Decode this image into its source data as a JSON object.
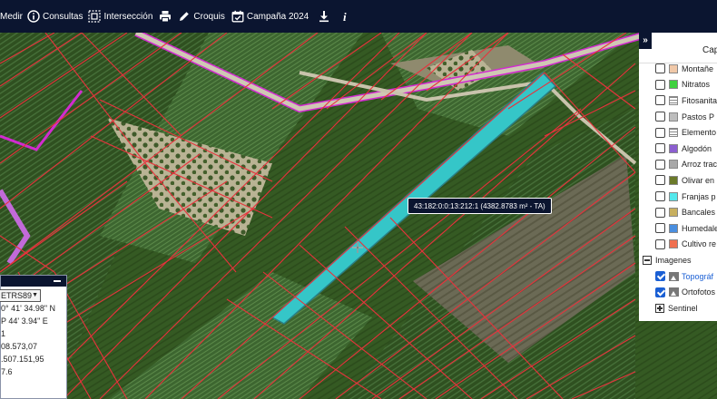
{
  "toolbar": {
    "items": [
      {
        "label": "Medir",
        "icon": "ruler-icon"
      },
      {
        "label": "Consultas",
        "icon": "info-circle-icon"
      },
      {
        "label": "Intersección",
        "icon": "intersection-icon"
      },
      {
        "label": "",
        "icon": "print-icon"
      },
      {
        "label": "Croquis",
        "icon": "pencil-icon"
      },
      {
        "label": "Campaña 2024",
        "icon": "calendar-check-icon"
      },
      {
        "label": "",
        "icon": "download-icon"
      },
      {
        "label": "",
        "icon": "info-italic-icon"
      }
    ]
  },
  "tooltip": {
    "text": "43:182:0:0:13:212:1 (4382.8783 m² - TA)"
  },
  "coord_panel": {
    "projection": "ETRS89",
    "lines": [
      "0° 41' 34.98\" N",
      "P 44' 3.94\" E",
      "1",
      "08.573,07",
      ".507.151,95",
      "7.6"
    ]
  },
  "layer_panel": {
    "title": "Cap",
    "layers": [
      {
        "label": "Montañe",
        "color": "#f0c8a8",
        "checked": false
      },
      {
        "label": "Nitratos",
        "color": "#3fd13f",
        "checked": false
      },
      {
        "label": "Fitosanita",
        "color": "lines",
        "checked": false
      },
      {
        "label": "Pastos P",
        "color": "#bdbdbd",
        "checked": false
      },
      {
        "label": "Elemento",
        "color": "lines",
        "checked": false
      },
      {
        "label": "Algodón",
        "color": "#8c5fd0",
        "checked": false
      },
      {
        "label": "Arroz trac",
        "color": "#a8a8a8",
        "checked": false
      },
      {
        "label": "Olivar en",
        "color": "#6b7a2a",
        "checked": false
      },
      {
        "label": "Franjas p",
        "color": "#54e8ec",
        "checked": false
      },
      {
        "label": "Bancales",
        "color": "#c8b060",
        "checked": false
      },
      {
        "label": "Humedale",
        "color": "#4a8fe0",
        "checked": false
      },
      {
        "label": "Cultivo re",
        "color": "#f07050",
        "checked": false
      }
    ],
    "group_label": "Imagenes",
    "images": [
      {
        "label": "Topográf",
        "checked": true
      },
      {
        "label": "Ortofotos",
        "checked": true
      }
    ],
    "sentinel_label": "Sentinel"
  },
  "colors": {
    "toolbar_bg": "#0b1530",
    "parcel_line": "#e8323c",
    "selected_fill": "#35c6c8",
    "road_outline": "#d22bd0"
  }
}
